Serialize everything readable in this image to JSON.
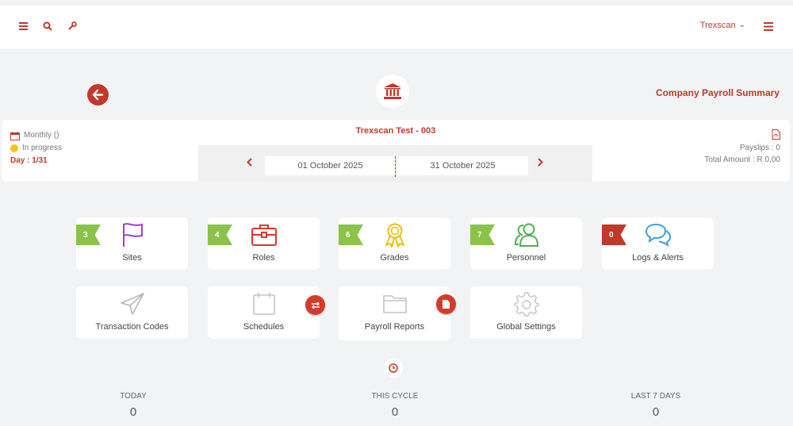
{
  "header": {
    "user_name": "Trexscan",
    "user_chevron": "⌄",
    "icons": [
      "hamburger-icon",
      "search-icon",
      "wrench-icon",
      "list-menu-icon"
    ]
  },
  "page": {
    "title": "Company Payroll Summary"
  },
  "summary": {
    "company": "Trexscan Test - 003",
    "frequency": "Monthly ()",
    "status": "In progress",
    "status_color": "#f1c40f",
    "day": "Day : 1/31",
    "start_date": "01 October 2025",
    "end_date": "31 October 2025",
    "payslips": "Payslips : 0",
    "total_amount": "Total Amount : R 0,00"
  },
  "modules": [
    {
      "label": "Sites",
      "count": "3",
      "icon": "flag-icon",
      "color": "#9b3fd6"
    },
    {
      "label": "Roles",
      "count": "4",
      "icon": "briefcase-icon",
      "color": "#d63a2c"
    },
    {
      "label": "Grades",
      "count": "6",
      "icon": "award-ribbon-icon",
      "color": "#e5c30b"
    },
    {
      "label": "Personnel",
      "count": "7",
      "icon": "users-icon",
      "color": "#4caf50"
    },
    {
      "label": "Logs & Alerts",
      "count": "0",
      "icon": "chat-bubbles-icon",
      "color": "#3f9fe0"
    },
    {
      "label": "Transaction Codes",
      "icon": "paper-plane-icon"
    },
    {
      "label": "Schedules",
      "icon": "calendar-icon"
    },
    {
      "label": "Payroll Reports",
      "icon": "folder-icon"
    },
    {
      "label": "Global Settings",
      "icon": "gear-icon"
    }
  ],
  "stats": [
    {
      "label": "TODAY",
      "value": "0"
    },
    {
      "label": "THIS CYCLE",
      "value": "0"
    },
    {
      "label": "LAST 7 DAYS",
      "value": "0"
    }
  ],
  "colors": {
    "accent": "#c0392b",
    "badge_green": "#8bc34a",
    "badge_red": "#c0392b"
  }
}
